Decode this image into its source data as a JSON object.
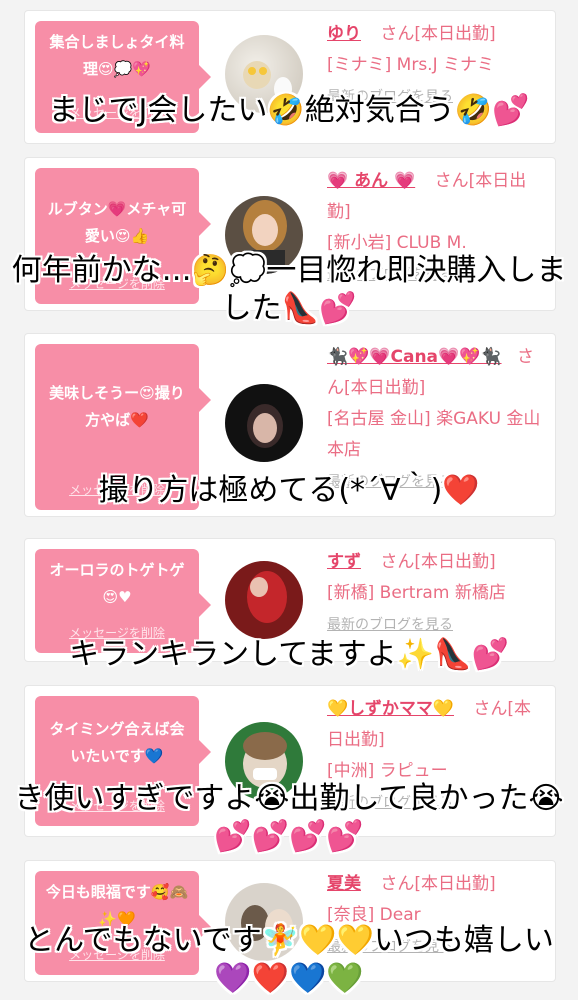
{
  "cards": [
    {
      "message": "集合しましょタイ料理😍💭💖",
      "delete_label": "メッセージを削除",
      "name": "ゆり",
      "suffix": "さん[本日出勤]",
      "shop": "[ミナミ] Mrs.J ミナミ",
      "blog_link": "最新のブログを見る",
      "overlay": "まじでJ会したい🤣絶対気合う🤣💕"
    },
    {
      "message": "ルブタン💗メチャ可愛い😍👍",
      "delete_label": "メッセージを削除",
      "name": "💗 あん 💗",
      "suffix": "さん[本日出勤]",
      "shop": "[新小岩] CLUB M.",
      "blog_link": "最新のブログを見る",
      "overlay": "何年前かな…🤔💭一目惚れ即決購入しました👠💕"
    },
    {
      "message": "美味しそうー😍撮り方やば❤️",
      "delete_label": "メッセージを削除",
      "name": "🐈‍⬛💖💗Cana💗💖🐈‍⬛",
      "suffix": "さん[本日出勤]",
      "shop": "[名古屋 金山] 楽GAKU 金山本店",
      "blog_link": "最新のブログを見る",
      "overlay": "撮り方は極めてる(*´∀｀)❤️"
    },
    {
      "message": "オーロラのトゲトゲ😍♥",
      "delete_label": "メッセージを削除",
      "name": "すず",
      "suffix": "さん[本日出勤]",
      "shop": "[新橋] Bertram 新橋店",
      "blog_link": "最新のブログを見る",
      "overlay": "キランキランしてますよ✨👠💕"
    },
    {
      "message": "タイミング合えば会いたいです💙",
      "delete_label": "メッセージを削除",
      "name": "💛しずかママ💛",
      "suffix": "さん[本日出勤]",
      "shop": "[中洲] ラピュー",
      "blog_link": "最新のブログを見る",
      "overlay": "き使いすぎですよ😭出勤して良かった😭💕💕💕💕"
    },
    {
      "message": "今日も眼福です🥰🙈✨🧡",
      "delete_label": "メッセージを削除",
      "name": "夏美",
      "suffix": "さん[本日出勤]",
      "shop": "[奈良] Dear",
      "blog_link": "最新のブログを見る",
      "overlay": "とんでもないです🧚💛💛いつも嬉しい💜❤️💙💚"
    }
  ],
  "colors": {
    "bubble": "#f78ea7",
    "accent": "#e5456a",
    "link": "#ea6d84"
  }
}
